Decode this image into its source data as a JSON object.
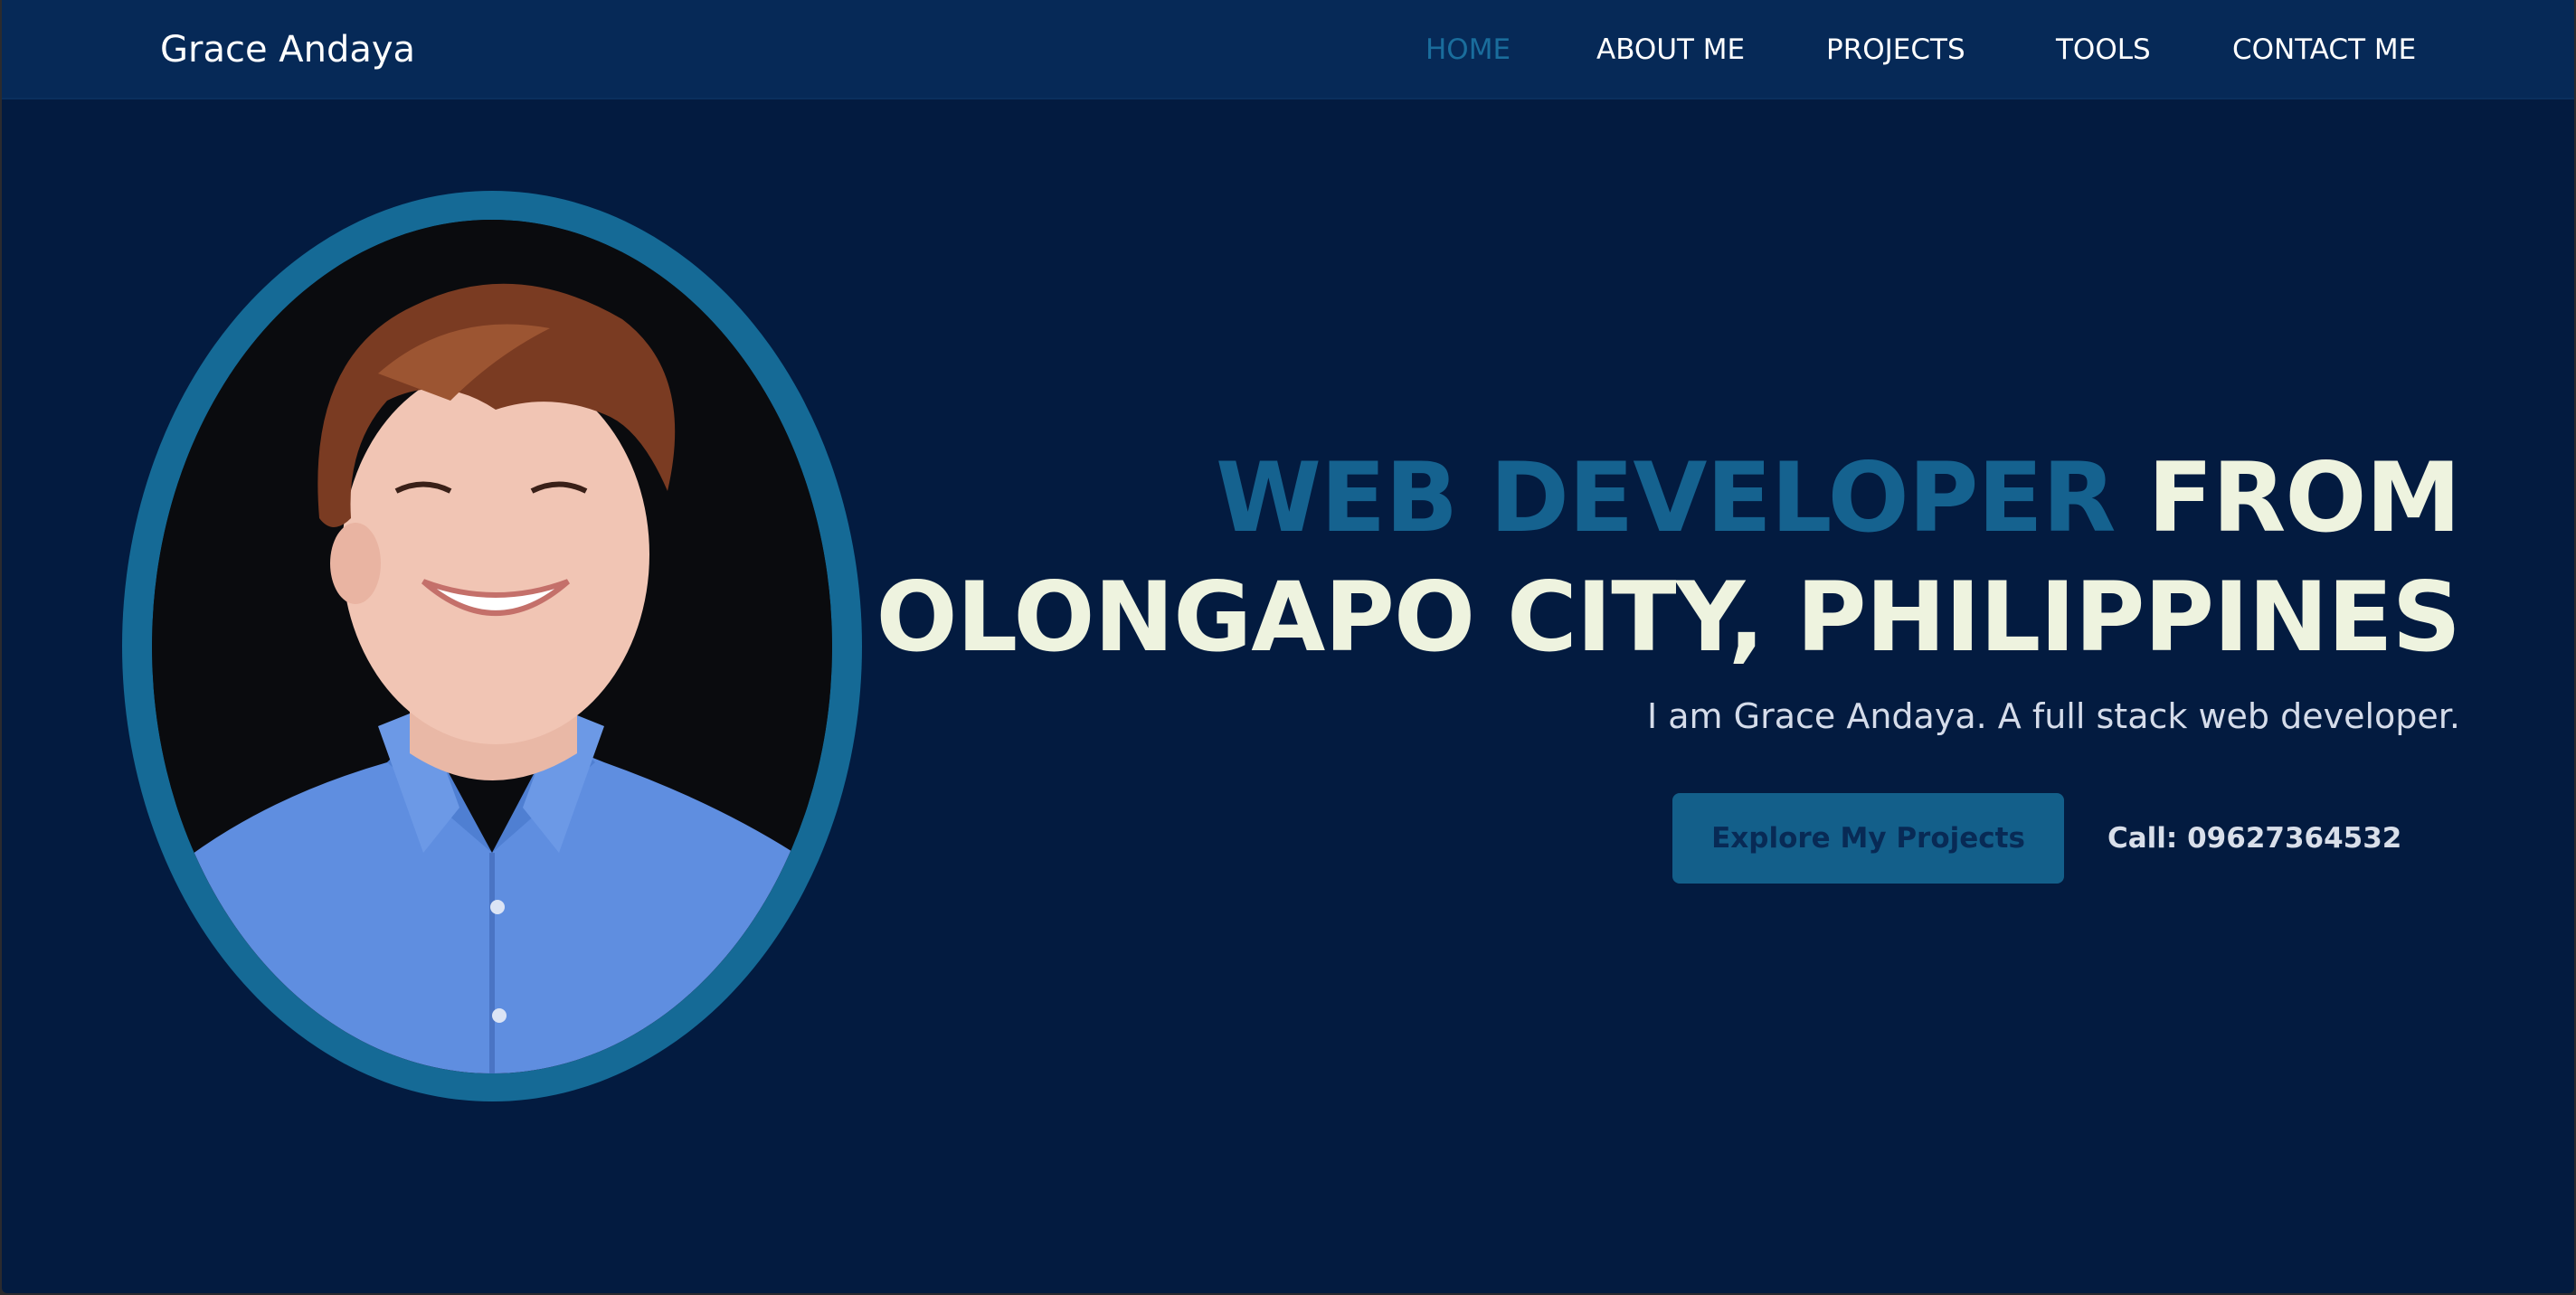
{
  "header": {
    "brand": "Grace Andaya",
    "nav": [
      {
        "label": "HOME",
        "active": true
      },
      {
        "label": "ABOUT ME",
        "active": false
      },
      {
        "label": "PROJECTS",
        "active": false
      },
      {
        "label": "TOOLS",
        "active": false
      },
      {
        "label": "CONTACT ME",
        "active": false
      }
    ]
  },
  "hero": {
    "title_accent": "WEB DEVELOPER",
    "title_rest": "FROM",
    "title_line2": "OLONGAPO CITY, PHILIPPINES",
    "subtitle": "I am Grace Andaya. A full stack web developer.",
    "cta_label": "Explore My Projects",
    "call_text": "Call: 09627364532"
  },
  "colors": {
    "background": "#031b40",
    "navbar": "#062957",
    "accent": "#15628f",
    "heading": "#eef3df",
    "button": "#135f8a",
    "button_text": "#082a55"
  },
  "icons": {
    "portrait": "profile-photo"
  }
}
